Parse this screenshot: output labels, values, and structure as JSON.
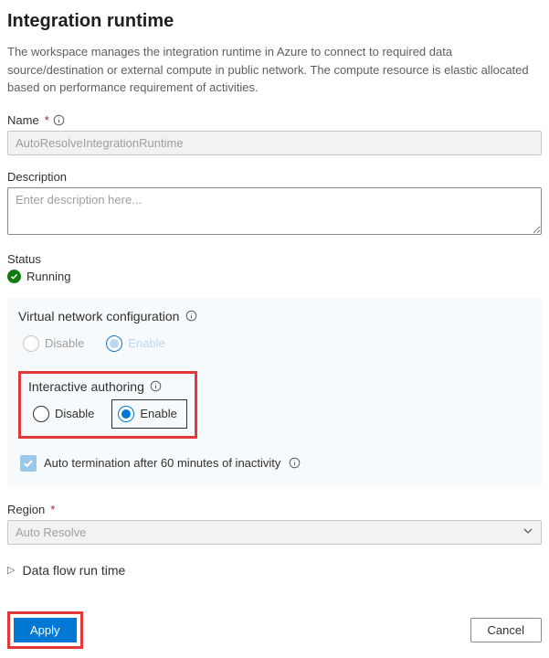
{
  "page": {
    "title": "Integration runtime",
    "intro": "The workspace manages the integration runtime in Azure to connect to required data source/destination or external compute in public network. The compute resource is elastic allocated based on performance requirement of activities."
  },
  "fields": {
    "name": {
      "label": "Name",
      "value": "AutoResolveIntegrationRuntime"
    },
    "description": {
      "label": "Description",
      "placeholder": "Enter description here..."
    },
    "status": {
      "label": "Status",
      "value": "Running"
    },
    "region": {
      "label": "Region",
      "value": "Auto Resolve"
    }
  },
  "config": {
    "vnet": {
      "heading": "Virtual network configuration",
      "disable_label": "Disable",
      "enable_label": "Enable"
    },
    "interactive": {
      "heading": "Interactive authoring",
      "disable_label": "Disable",
      "enable_label": "Enable"
    },
    "auto_term": {
      "label": "Auto termination after 60 minutes of inactivity"
    }
  },
  "expander": {
    "dataflow_label": "Data flow run time"
  },
  "buttons": {
    "apply": "Apply",
    "cancel": "Cancel"
  }
}
